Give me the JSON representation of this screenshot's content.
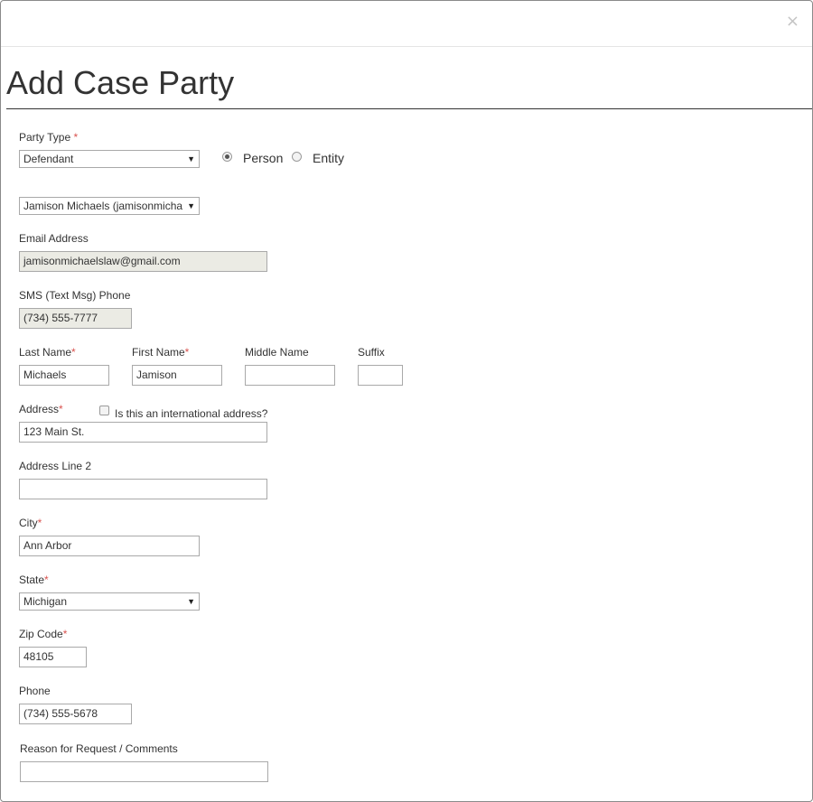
{
  "dialog": {
    "title": "Add Case Party",
    "close_symbol": "×"
  },
  "party_type": {
    "label": "Party Type",
    "required_mark": "*",
    "selected": "Defendant",
    "options": {
      "person": "Person",
      "entity": "Entity"
    },
    "selected_option": "person"
  },
  "attorney_select": {
    "selected": "Jamison Michaels (jamisonmicha"
  },
  "email": {
    "label": "Email Address",
    "value": "jamisonmichaelslaw@gmail.com"
  },
  "sms_phone": {
    "label": "SMS (Text Msg) Phone",
    "value": "(734) 555-7777"
  },
  "last_name": {
    "label": "Last Name",
    "required_mark": "*",
    "value": "Michaels"
  },
  "first_name": {
    "label": "First Name",
    "required_mark": "*",
    "value": "Jamison"
  },
  "middle_name": {
    "label": "Middle Name",
    "value": ""
  },
  "suffix": {
    "label": "Suffix",
    "value": ""
  },
  "address": {
    "label": "Address",
    "required_mark": "*",
    "international_label": "Is this an international address?",
    "value": "123 Main St."
  },
  "address2": {
    "label": "Address Line 2",
    "value": ""
  },
  "city": {
    "label": "City",
    "required_mark": "*",
    "value": "Ann Arbor"
  },
  "state": {
    "label": "State",
    "required_mark": "*",
    "selected": "Michigan"
  },
  "zip": {
    "label": "Zip Code",
    "required_mark": "*",
    "value": "48105"
  },
  "phone": {
    "label": "Phone",
    "value": "(734) 555-5678"
  },
  "comments": {
    "label": "Reason for Request / Comments",
    "value": ""
  },
  "dropdown_arrow": "▼"
}
